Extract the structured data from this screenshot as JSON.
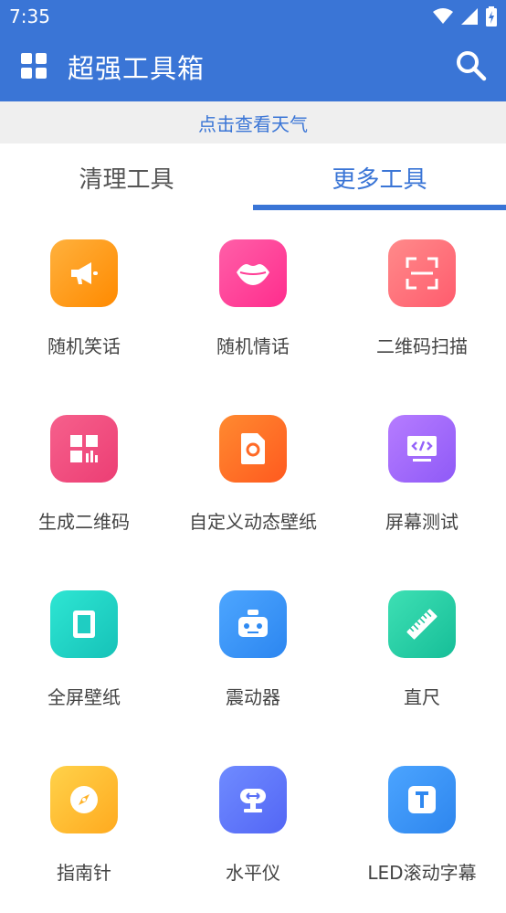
{
  "status": {
    "time": "7:35"
  },
  "app": {
    "title": "超强工具箱"
  },
  "weather": {
    "label": "点击查看天气"
  },
  "tabs": [
    {
      "label": "清理工具",
      "selected": false
    },
    {
      "label": "更多工具",
      "selected": true
    }
  ],
  "tools": [
    {
      "label": "随机笑话",
      "icon": "megaphone-icon",
      "colors": [
        "#FFB13D",
        "#FF8A00"
      ]
    },
    {
      "label": "随机情话",
      "icon": "lips-icon",
      "colors": [
        "#FF5FA8",
        "#FF2D8D"
      ]
    },
    {
      "label": "二维码扫描",
      "icon": "scan-icon",
      "colors": [
        "#FF8A8A",
        "#FF5C6E"
      ]
    },
    {
      "label": "生成二维码",
      "icon": "qr-generate-icon",
      "colors": [
        "#F6608C",
        "#EC3E74"
      ]
    },
    {
      "label": "自定义动态壁纸",
      "icon": "live-wallpaper-icon",
      "colors": [
        "#FF8A30",
        "#FF5A1F"
      ]
    },
    {
      "label": "屏幕测试",
      "icon": "code-screen-icon",
      "colors": [
        "#B67CFF",
        "#8F5AF7"
      ]
    },
    {
      "label": "全屏壁纸",
      "icon": "tablet-icon",
      "colors": [
        "#2EE6D3",
        "#16C2B8"
      ]
    },
    {
      "label": "震动器",
      "icon": "robot-icon",
      "colors": [
        "#4DA6FF",
        "#2C86F0"
      ]
    },
    {
      "label": "直尺",
      "icon": "ruler-icon",
      "colors": [
        "#3EE0B4",
        "#16BE98"
      ]
    },
    {
      "label": "指南针",
      "icon": "compass-icon",
      "colors": [
        "#FFD24A",
        "#FFAA1F"
      ]
    },
    {
      "label": "水平仪",
      "icon": "level-icon",
      "colors": [
        "#6F8BFF",
        "#5366F5"
      ]
    },
    {
      "label": "LED滚动字幕",
      "icon": "text-t-icon",
      "colors": [
        "#4BA4FF",
        "#2E86EE"
      ]
    }
  ]
}
